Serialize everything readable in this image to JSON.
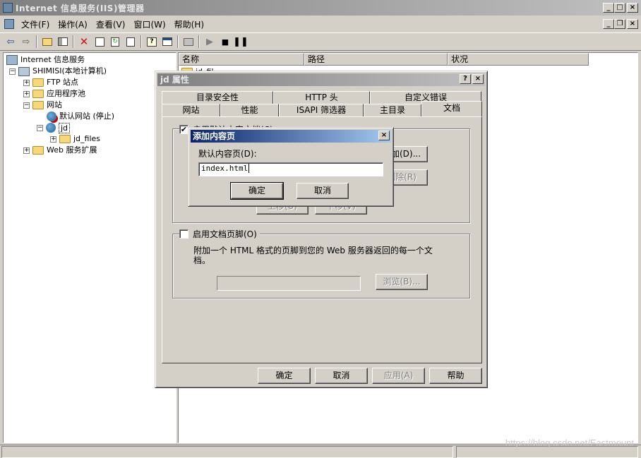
{
  "app": {
    "title": "Internet 信息服务(IIS)管理器",
    "title_buttons": [
      "_",
      "□",
      "×"
    ],
    "mdi_buttons": [
      "_",
      "❐",
      "×"
    ]
  },
  "menu": [
    "文件(F)",
    "操作(A)",
    "查看(V)",
    "窗口(W)",
    "帮助(H)"
  ],
  "toolbar": [
    "back-icon",
    "forward-icon",
    "up-folder-icon",
    "show-tree-icon",
    "delete-icon",
    "properties-icon",
    "refresh-icon",
    "export-icon",
    "help-icon",
    "mmc-icon",
    "computer-icon",
    "play-icon",
    "stop-icon",
    "pause-icon"
  ],
  "tree": {
    "root": "Internet 信息服务",
    "computer": "SHIMISI(本地计算机)",
    "ftp": "FTP 站点",
    "apppools": "应用程序池",
    "websites": "网站",
    "default_site": "默认网站 (停止)",
    "jd": "jd",
    "jd_files": "jd_files",
    "webext": "Web 服务扩展"
  },
  "list": {
    "columns": [
      "名称",
      "路径",
      "状况"
    ],
    "first_item": "jd_fil"
  },
  "dialog": {
    "title": "jd 属性",
    "title_buttons": [
      "?",
      "×"
    ],
    "tabs_row1": [
      "目录安全性",
      "HTTP 头",
      "自定义错误"
    ],
    "tabs_row2": [
      "网站",
      "性能",
      "ISAPI 筛选器",
      "主目录",
      "文档"
    ],
    "active_tab": "文档",
    "enable_default": "启用默认内容文档(C)",
    "add_btn": "添加(D)...",
    "remove_btn": "删除(R)",
    "up_btn": "上移(U)",
    "down_btn": "下移(V)",
    "enable_footer": "启用文档页脚(O)",
    "footer_desc": "附加一个 HTML 格式的页脚到您的 Web 服务器返回的每一个文档。",
    "browse_btn": "浏览(B)...",
    "ok": "确定",
    "cancel": "取消",
    "apply": "应用(A)",
    "help": "帮助"
  },
  "add_dialog": {
    "title": "添加内容页",
    "label": "默认内容页(D):",
    "value": "index.html",
    "ok": "确定",
    "cancel": "取消",
    "close": "×"
  },
  "watermark": "https://blog.csdn.net/Eastmount"
}
